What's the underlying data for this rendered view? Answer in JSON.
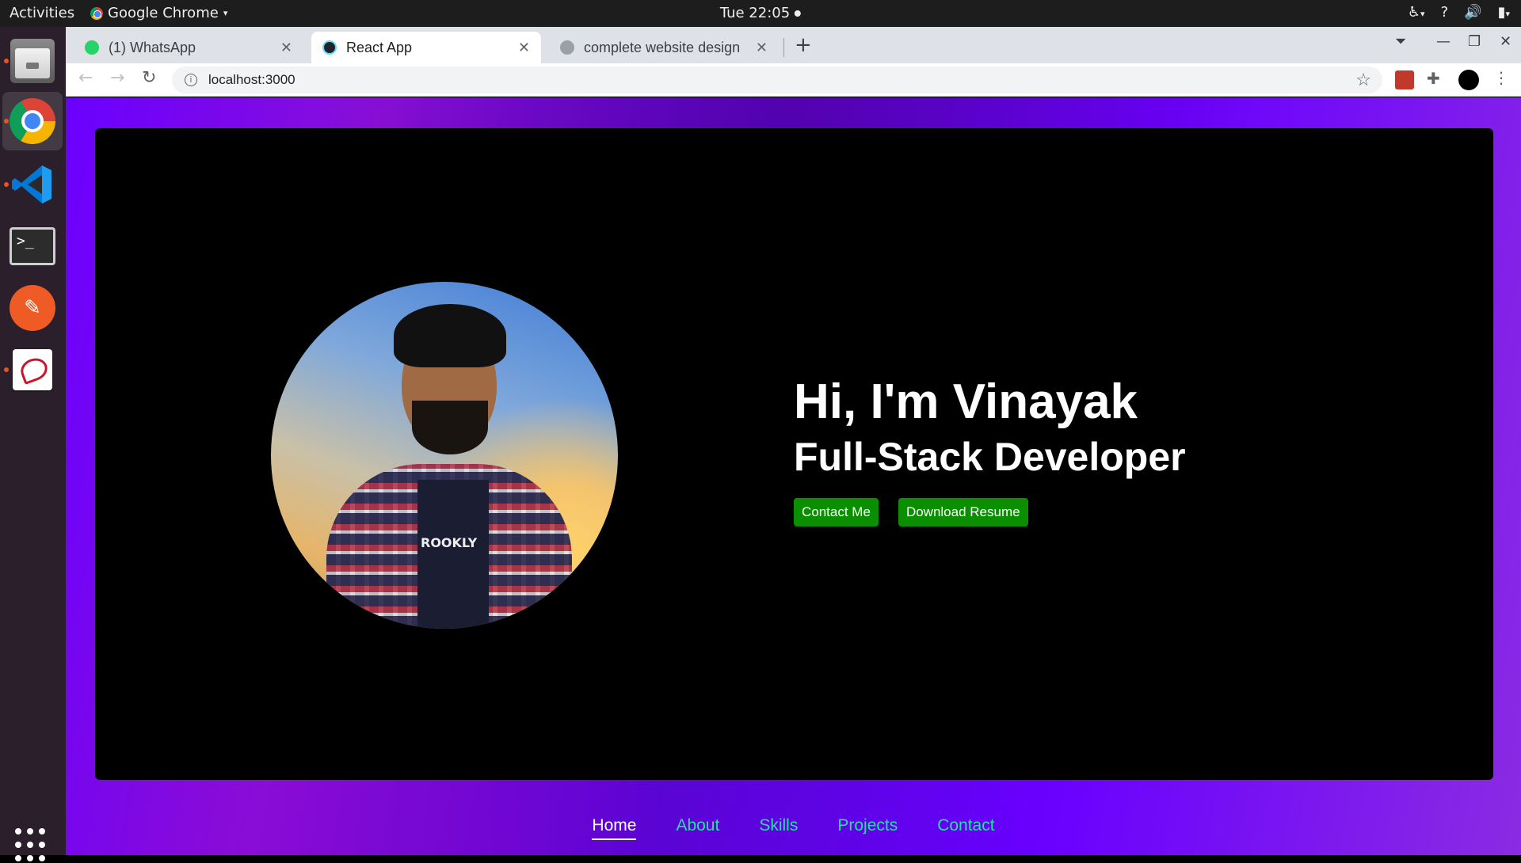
{
  "system": {
    "activities": "Activities",
    "app_menu": "Google Chrome",
    "clock": "Tue 22:05"
  },
  "browser": {
    "tabs": [
      {
        "label": "(1) WhatsApp",
        "active": false
      },
      {
        "label": "React App",
        "active": true
      },
      {
        "label": "complete website design",
        "active": false
      }
    ],
    "url": "localhost:3000"
  },
  "hero": {
    "greeting": "Hi, I'm Vinayak",
    "role": "Full-Stack Developer",
    "contact_button": "Contact Me",
    "resume_button": "Download Resume",
    "tee_text": "ROOKLY"
  },
  "nav": {
    "items": [
      {
        "label": "Home",
        "active": true
      },
      {
        "label": "About",
        "active": false
      },
      {
        "label": "Skills",
        "active": false
      },
      {
        "label": "Projects",
        "active": false
      },
      {
        "label": "Contact",
        "active": false
      }
    ]
  },
  "colors": {
    "accent_green": "#0a8f00",
    "nav_link": "#26e0a8",
    "page_gradient": "#6a00ff"
  }
}
